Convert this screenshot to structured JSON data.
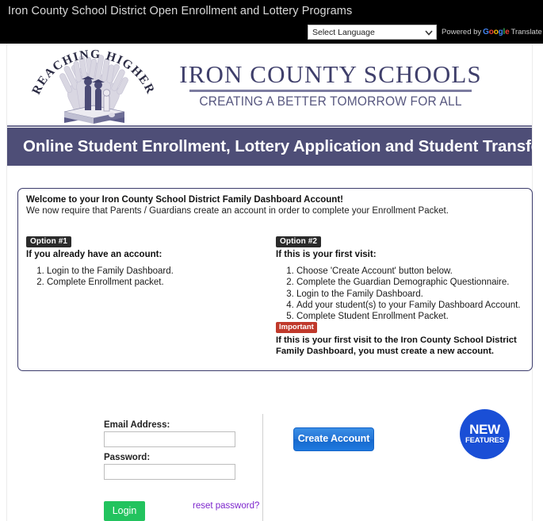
{
  "topbar": {
    "title": "Iron County School District Open Enrollment and Lottery Programs",
    "language_select_value": "Select Language",
    "chevron_icon": "chevron-down-icon",
    "powered_by_prefix": "Powered by",
    "google_letters": [
      "G",
      "o",
      "o",
      "g",
      "l",
      "e"
    ],
    "powered_by_suffix": "Translate"
  },
  "logo": {
    "seal_icon": "reaching-higher-seal",
    "seal_arc_text": "REACHING HIGHER",
    "district_name": "IRON COUNTY SCHOOLS",
    "tagline": "CREATING A BETTER TOMORROW FOR ALL"
  },
  "banner": {
    "text": "Online Student Enrollment, Lottery Application and Student Transfer",
    "color": "#4e4e77"
  },
  "infobox": {
    "welcome_title": "Welcome to your Iron County School District  Family Dashboard Account!",
    "welcome_subtitle": "We now require that Parents / Guardians create an account in order to complete your Enrollment Packet.",
    "option1": {
      "badge": "Option #1",
      "heading": "If you already have an account:",
      "steps": [
        "Login to the Family Dashboard.",
        "Complete Enrollment packet."
      ]
    },
    "option2": {
      "badge": "Option #2",
      "heading": "If this is your first visit:",
      "steps": [
        "Choose 'Create Account' button below.",
        "Complete the Guardian Demographic Questionnaire.",
        "Login to the Family Dashboard.",
        "Add your student(s) to your Family Dashboard Account.",
        "Complete Student Enrollment Packet."
      ]
    },
    "important": {
      "badge": "Important",
      "badge_color": "#c0392b",
      "text": "If this is your first visit to the Iron County School District Family Dashboard, you must create a new account."
    }
  },
  "new_features_badge": {
    "line1": "NEW",
    "line2": "FEATURES",
    "color": "#1a4fd6"
  },
  "login_form": {
    "email_label": "Email Address:",
    "email_value": "",
    "email_placeholder": "",
    "password_label": "Password:",
    "password_value": "",
    "password_placeholder": "",
    "login_button": "Login",
    "login_button_color": "#22c35e",
    "reset_link": "reset password?",
    "reset_link_color": "#7d26cd"
  },
  "create_account": {
    "button_label": "Create Account",
    "button_color": "#2575d6"
  }
}
